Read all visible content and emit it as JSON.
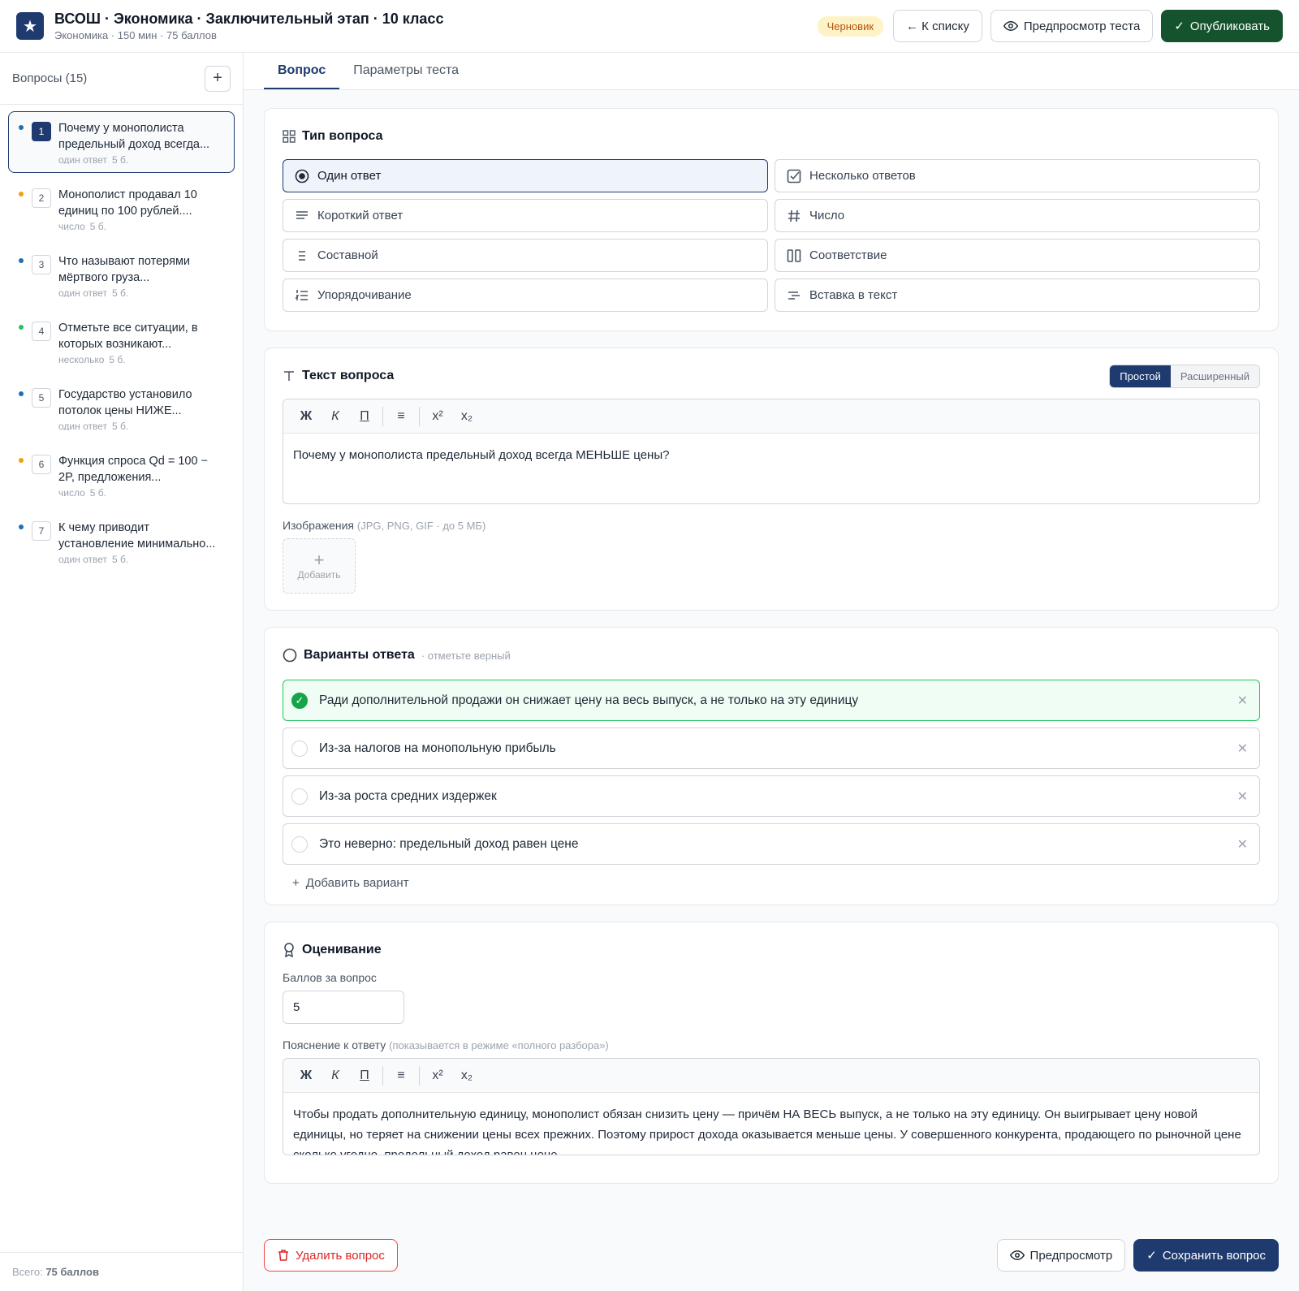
{
  "header": {
    "title": "ВСОШ · Экономика · Заключительный этап · 10 класс",
    "subtitle": "Экономика · 150 мин · 75 баллов",
    "status_badge": "Черновик",
    "back_label": "← К списку",
    "preview_label": "Предпросмотр теста",
    "publish_label": "Опубликовать"
  },
  "sidebar": {
    "heading": "Вопросы (15)",
    "total_prefix": "Всего:",
    "total_value": "75 баллов",
    "items": [
      {
        "num": "1",
        "text": "Почему у монополиста предельный доход всегда...",
        "type": "один ответ",
        "points": "5 б.",
        "dot": "#1d6fb8",
        "active": true
      },
      {
        "num": "2",
        "text": "Монополист продавал 10 единиц по 100 рублей....",
        "type": "число",
        "points": "5 б.",
        "dot": "#f59e0b"
      },
      {
        "num": "3",
        "text": "Что называют потерями мёртвого груза...",
        "type": "один ответ",
        "points": "5 б.",
        "dot": "#1d6fb8"
      },
      {
        "num": "4",
        "text": "Отметьте все ситуации, в которых возникают...",
        "type": "несколько",
        "points": "5 б.",
        "dot": "#22c55e"
      },
      {
        "num": "5",
        "text": "Государство установило потолок цены НИЖЕ...",
        "type": "один ответ",
        "points": "5 б.",
        "dot": "#1d6fb8"
      },
      {
        "num": "6",
        "text": "Функция спроса Qd = 100 − 2P, предложения...",
        "type": "число",
        "points": "5 б.",
        "dot": "#f59e0b"
      },
      {
        "num": "7",
        "text": "К чему приводит установление минимально...",
        "type": "один ответ",
        "points": "5 б.",
        "dot": "#1d6fb8"
      }
    ]
  },
  "tabs": [
    {
      "label": "Вопрос",
      "active": true
    },
    {
      "label": "Параметры теста",
      "active": false
    }
  ],
  "question_type": {
    "title": "Тип вопроса",
    "options": [
      {
        "label": "Один ответ",
        "icon": "radio-target-icon",
        "active": true
      },
      {
        "label": "Несколько ответов",
        "icon": "checkbox-icon"
      },
      {
        "label": "Короткий ответ",
        "icon": "text-lines-icon"
      },
      {
        "label": "Число",
        "icon": "hash-icon"
      },
      {
        "label": "Составной",
        "icon": "list-icon"
      },
      {
        "label": "Соответствие",
        "icon": "columns-icon"
      },
      {
        "label": "Упорядочивание",
        "icon": "ordered-list-icon"
      },
      {
        "label": "Вставка в текст",
        "icon": "text-insert-icon"
      }
    ]
  },
  "question_text": {
    "title": "Текст вопроса",
    "mode_simple": "Простой",
    "mode_extended": "Расширенный",
    "toolbar": {
      "bold": "Ж",
      "italic": "К",
      "underline": "П",
      "list": "≡",
      "sup": "x²",
      "sub": "x₂"
    },
    "content": "Почему у монополиста предельный доход всегда МЕНЬШЕ цены?",
    "images_label": "Изображения",
    "images_hint": "(JPG, PNG, GIF · до 5 МБ)",
    "add_image": "Добавить"
  },
  "answers": {
    "title": "Варианты ответа",
    "hint": "· отметьте верный",
    "items": [
      {
        "text": "Ради дополнительной продажи он снижает цену на весь выпуск, а не только на эту единицу",
        "correct": true
      },
      {
        "text": "Из-за налогов на монопольную прибыль",
        "correct": false
      },
      {
        "text": "Из-за роста средних издержек",
        "correct": false
      },
      {
        "text": "Это неверно: предельный доход равен цене",
        "correct": false
      }
    ],
    "add_label": "Добавить вариант"
  },
  "grading": {
    "title": "Оценивание",
    "points_label": "Баллов за вопрос",
    "points_value": "5",
    "explanation_label": "Пояснение к ответу",
    "explanation_hint": "(показывается в режиме «полного разбора»)",
    "explanation_text": "Чтобы продать дополнительную единицу, монополист обязан снизить цену — причём НА ВЕСЬ выпуск, а не только на эту единицу. Он выигрывает цену новой единицы, но теряет на снижении цены всех прежних. Поэтому прирост дохода оказывается меньше цены. У совершенного конкурента, продающего по рыночной цене сколько угодно, предельный доход равен цене."
  },
  "footer": {
    "delete_label": "Удалить вопрос",
    "preview_label": "Предпросмотр",
    "save_label": "Сохранить вопрос"
  }
}
